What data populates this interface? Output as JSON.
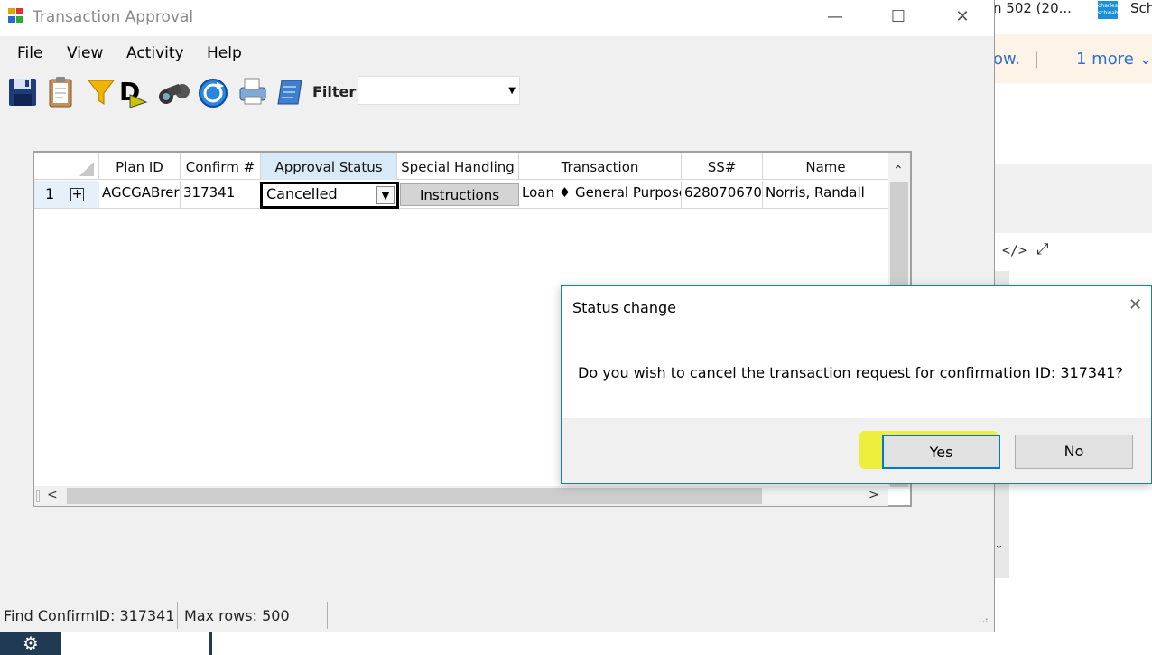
{
  "window": {
    "title": "Transaction Approval",
    "minimize": "—",
    "maximize": "☐",
    "close": "✕"
  },
  "menu": [
    "File",
    "View",
    "Activity",
    "Help"
  ],
  "toolbar": {
    "icons": [
      "save-icon",
      "clipboard-icon",
      "filter-funnel-icon",
      "d-arrow-icon",
      "binoculars-icon",
      "refresh-circle-icon",
      "print-icon",
      "notes-icon"
    ],
    "filter_label": "Filter:",
    "filter_value": ""
  },
  "grid": {
    "columns": [
      "Plan ID",
      "Confirm #",
      "Approval Status",
      "Special Handling",
      "Transaction",
      "SS#",
      "Name"
    ],
    "rows": [
      {
        "row_number": "1",
        "expander": "+",
        "plan_id": "AGCGABrer",
        "confirm": "317341",
        "approval_status": "Cancelled",
        "special_handling": "Instructions",
        "transaction": "Loan ♦ General Purpose",
        "ss": "628070670",
        "name": "Norris, Randall"
      }
    ]
  },
  "statusbar": {
    "find": "Find ConfirmID: 317341",
    "max_rows": "Max rows: 500"
  },
  "dialog": {
    "title": "Status change",
    "message": "Do you wish to cancel the transaction request for confirmation ID: 317341?",
    "yes": "Yes",
    "no": "No",
    "close": "✕"
  },
  "background": {
    "tab_text": "n 502 (20...",
    "tab_text2": "Sch",
    "logo_text": "charles schwab",
    "banner_text": "ow.",
    "banner_sep": "|",
    "banner_more": "1 more ⌄",
    "code_icon": "</>",
    "expand_icon": "⤢"
  },
  "taskbar": {
    "settings_icon": "⚙"
  }
}
